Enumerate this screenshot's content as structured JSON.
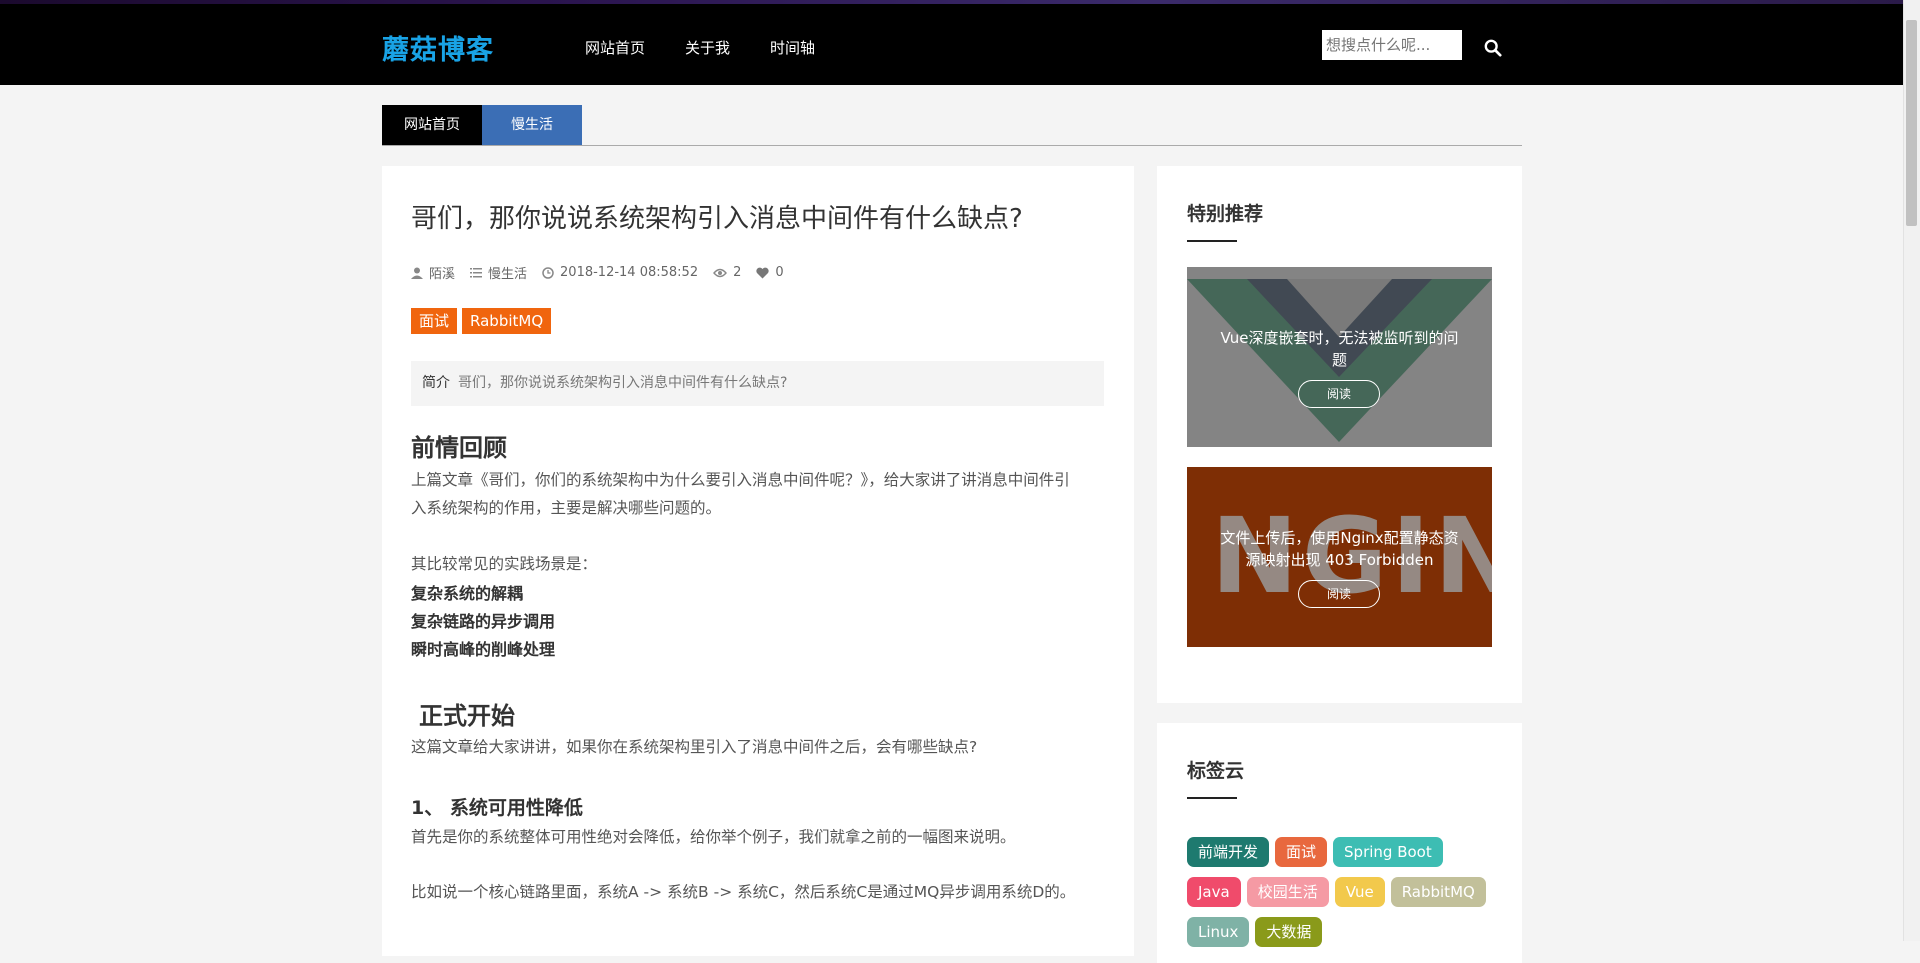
{
  "header": {
    "logo": "蘑菇博客",
    "nav": [
      "网站首页",
      "关于我",
      "时间轴"
    ],
    "search_placeholder": "想搜点什么呢..."
  },
  "breadcrumb": {
    "home": "网站首页",
    "category": "慢生活"
  },
  "article": {
    "title": "哥们，那你说说系统架构引入消息中间件有什么缺点?",
    "author": "陌溪",
    "category": "慢生活",
    "date": "2018-12-14 08:58:52",
    "views": "2",
    "likes": "0",
    "tags": [
      "面试",
      "RabbitMQ"
    ],
    "summary_label": "简介",
    "summary": "哥们，那你说说系统架构引入消息中间件有什么缺点?",
    "h_prev": "前情回顾",
    "p_prev_1": "上篇文章《哥们，你们的系统架构中为什么要引入消息中间件呢？》，给大家讲了讲消息中间件引",
    "p_prev_2": "入系统架构的作用，主要是解决哪些问题的。",
    "p_common": "其比较常见的实践场景是：",
    "b1": "复杂系统的解耦",
    "b2": "复杂链路的异步调用",
    "b3": "瞬时高峰的削峰处理",
    "h_start": "正式开始",
    "p_start": "这篇文章给大家讲讲，如果你在系统架构里引入了消息中间件之后，会有哪些缺点?",
    "h_1": "1、 系统可用性降低",
    "p_1": "首先是你的系统整体可用性绝对会降低，给你举个例子，我们就拿之前的一幅图来说明。",
    "p_2": "比如说一个核心链路里面，系统A -> 系统B -> 系统C，然后系统C是通过MQ异步调用系统D的。"
  },
  "recommend": {
    "title": "特别推荐",
    "cards": [
      {
        "text": "Vue深度嵌套时，无法被监听到的问题",
        "button": "阅读"
      },
      {
        "text": "文件上传后，使用Nginx配置静态资源映射出现 403 Forbidden",
        "button": "阅读",
        "image_text": "NGINX"
      }
    ]
  },
  "tag_cloud": {
    "title": "标签云",
    "tags": [
      {
        "label": "前端开发",
        "color": "#1e7a6f"
      },
      {
        "label": "面试",
        "color": "#e8683e"
      },
      {
        "label": "Spring Boot",
        "color": "#3dbdb3"
      },
      {
        "label": "Java",
        "color": "#f04b6b"
      },
      {
        "label": "校园生活",
        "color": "#f59aa4"
      },
      {
        "label": "Vue",
        "color": "#f2c94c"
      },
      {
        "label": "RabbitMQ",
        "color": "#c2c09a"
      },
      {
        "label": "Linux",
        "color": "#7fb2a6"
      },
      {
        "label": "大数据",
        "color": "#8a9a1a"
      }
    ]
  },
  "colors": {
    "logo": "#19a3e6",
    "tag": "#f0650e",
    "breadcrumb_active": "#3b6eb5"
  }
}
